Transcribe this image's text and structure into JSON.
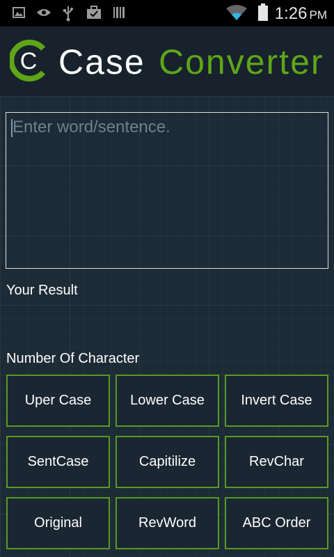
{
  "status_bar": {
    "time": "1:26",
    "ampm": "PM",
    "icons": [
      "image-icon",
      "eye-icon",
      "usb-icon",
      "briefcase-icon",
      "barcode-icon",
      "wifi-icon",
      "battery-icon"
    ]
  },
  "header": {
    "logo_letter": "C",
    "title_part1": "Case",
    "title_part2": "Converter",
    "accent_color": "#5ea618"
  },
  "input": {
    "placeholder": "Enter word/sentence.",
    "value": ""
  },
  "result_label": "Your Result",
  "result_value": "",
  "count_label": "Number Of Character",
  "buttons": {
    "uper_case": "Uper Case",
    "lower_case": "Lower Case",
    "invert_case": "Invert Case",
    "sent_case": "SentCase",
    "capitilize": "Capitilize",
    "rev_char": "RevChar",
    "original": "Original",
    "rev_word": "RevWord",
    "abc_order": "ABC Order"
  }
}
